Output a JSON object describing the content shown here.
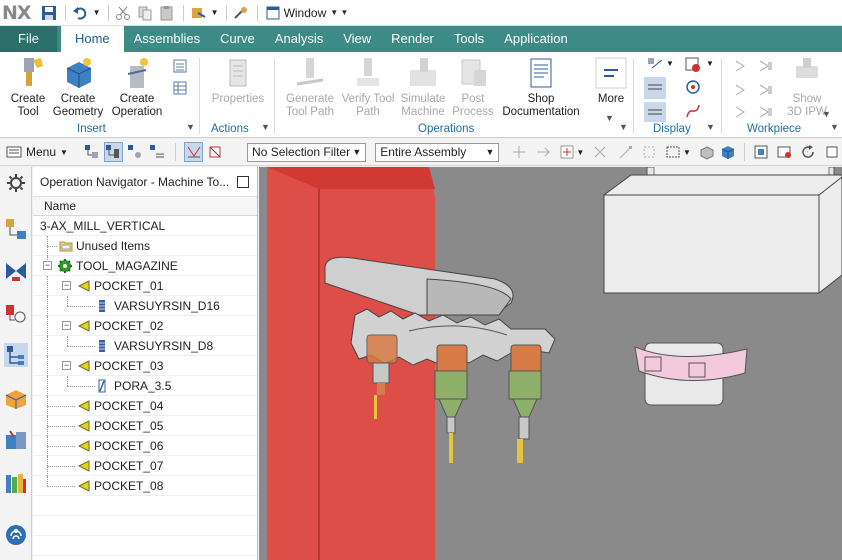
{
  "app": {
    "logo": "NX"
  },
  "window_menu": {
    "label": "Window"
  },
  "tabs": [
    {
      "label": "File"
    },
    {
      "label": "Home"
    },
    {
      "label": "Assemblies"
    },
    {
      "label": "Curve"
    },
    {
      "label": "Analysis"
    },
    {
      "label": "View"
    },
    {
      "label": "Render"
    },
    {
      "label": "Tools"
    },
    {
      "label": "Application"
    }
  ],
  "ribbon": {
    "create_tool": "Create Tool",
    "create_geometry": "Create Geometry",
    "create_operation": "Create Operation",
    "properties": "Properties",
    "generate_tool_path": "Generate Tool Path",
    "verify_tool_path": "Verify Tool Path",
    "simulate_machine": "Simulate Machine",
    "post_process": "Post Process",
    "shop_documentation": "Shop Documentation",
    "more": "More",
    "show_3d_ipw": "Show 3D IPW",
    "groups": {
      "insert": "Insert",
      "actions": "Actions",
      "operations": "Operations",
      "display": "Display",
      "workpiece": "Workpiece"
    }
  },
  "toolbar": {
    "menu": "Menu",
    "selection_filter": "No Selection Filter",
    "scope": "Entire Assembly"
  },
  "navigator": {
    "title": "Operation Navigator - Machine To...",
    "column_name": "Name",
    "rows": [
      {
        "label": "3-AX_MILL_VERTICAL"
      },
      {
        "label": "Unused Items"
      },
      {
        "label": "TOOL_MAGAZINE"
      },
      {
        "label": "POCKET_01"
      },
      {
        "label": "VARSUYRSIN_D16"
      },
      {
        "label": "POCKET_02"
      },
      {
        "label": "VARSUYRSIN_D8"
      },
      {
        "label": "POCKET_03"
      },
      {
        "label": "PORA_3.5"
      },
      {
        "label": "POCKET_04"
      },
      {
        "label": "POCKET_05"
      },
      {
        "label": "POCKET_06"
      },
      {
        "label": "POCKET_07"
      },
      {
        "label": "POCKET_08"
      }
    ]
  },
  "colors": {
    "accent": "#3d8b86",
    "file_tab": "#2b6f6a",
    "viewport_bg": "#888888",
    "red_part": "#e4473f"
  }
}
